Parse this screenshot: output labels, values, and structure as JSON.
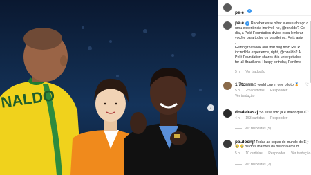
{
  "post": {
    "username": "pele",
    "verified": true,
    "caption_lines": [
      "Receber esse olhar e esse abraço d",
      "uma experiência incrível, né, @ronaldo? Ce",
      "dia, a Pelé Foundation divide essa lembrar",
      "você e para todos os brasileiros. Feliz aniv",
      ".",
      "Getting that look and that hug from Rei P",
      "incredible experience, right, @ronaldo? A",
      "Pelé Foundation shares this unforgettable",
      "for all Brazilians. Happy birthday, Fenôme"
    ],
    "time": "5 h",
    "see_translation": "Ver tradução"
  },
  "comments": [
    {
      "username": "1.7tomm",
      "text_lines": [
        "5 world cup in one photo 🏅"
      ],
      "time": "5 h",
      "likes": "259 curtidas",
      "reply": "Responder",
      "translate": "Ver tradução",
      "replies": ""
    },
    {
      "username": "dnvieiraszj",
      "text_lines": [
        "Só essa foto já é maior que a"
      ],
      "time": "4 h",
      "likes": "153 curtidas",
      "reply": "Responder",
      "translate": "",
      "replies": "Ver respostas (5)"
    },
    {
      "username": "paulocnjf",
      "text_lines": [
        "Todas as copas do mundo do E",
        "🥹🥹 os dois maiores da história em um"
      ],
      "time": "5 h",
      "likes": "10 curtidas",
      "reply": "Responder",
      "translate": "Ver tradução",
      "replies": "Ver respostas (2)"
    }
  ],
  "photo": {
    "jersey_text": "NALDO",
    "nav_icon": "chevron-right-icon"
  }
}
